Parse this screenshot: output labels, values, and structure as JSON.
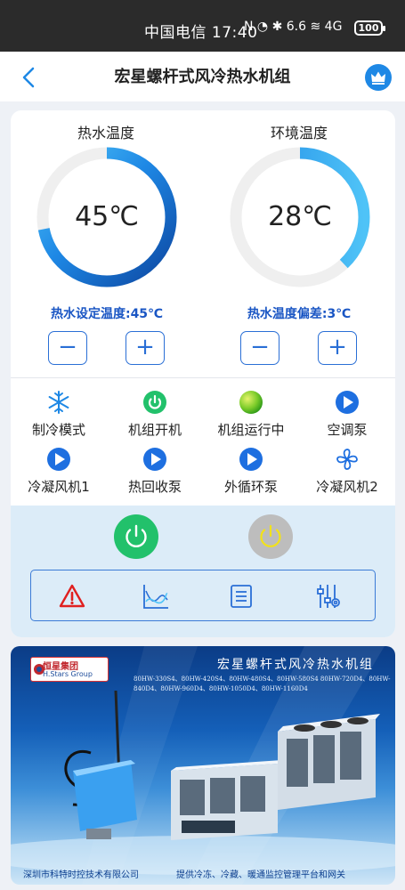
{
  "statusbar": {
    "carrier_time": "中国电信 17:40",
    "indicators": "N ◔ ✱ 6.6 ≋ 4G",
    "battery": "100"
  },
  "header": {
    "title": "宏星螺杆式风冷热水机组",
    "back_icon": "chevron-left-icon",
    "crown_icon": "crown-icon"
  },
  "gauges": {
    "hot_water": {
      "label": "热水温度",
      "value": "45℃",
      "fill": 0.72,
      "color_start": "#1565c0",
      "color_end": "#4fc3f7"
    },
    "ambient": {
      "label": "环境温度",
      "value": "28℃",
      "fill": 0.38,
      "color_start": "#1e88e5",
      "color_end": "#4fc3f7"
    }
  },
  "settings": {
    "setpoint": {
      "text": "热水设定温度:45℃",
      "minus": "−",
      "plus": "+"
    },
    "deviation": {
      "text": "热水温度偏差:3℃",
      "minus": "−",
      "plus": "+"
    }
  },
  "status_items": [
    {
      "label": "制冷模式",
      "icon": "snowflake-icon"
    },
    {
      "label": "机组开机",
      "icon": "power-green-icon"
    },
    {
      "label": "机组运行中",
      "icon": "running-light-icon"
    },
    {
      "label": "空调泵",
      "icon": "play-icon"
    },
    {
      "label": "冷凝风机1",
      "icon": "play-icon"
    },
    {
      "label": "热回收泵",
      "icon": "play-icon"
    },
    {
      "label": "外循环泵",
      "icon": "play-icon"
    },
    {
      "label": "冷凝风机2",
      "icon": "fan-icon"
    }
  ],
  "controls": {
    "power_on_icon": "power-on-icon",
    "power_off_icon": "power-off-icon",
    "tools": [
      "alarm-icon",
      "trend-chart-icon",
      "list-icon",
      "settings-sliders-icon"
    ]
  },
  "banner": {
    "logo_cn": "恒星集团",
    "logo_en": "H.Stars Group",
    "title": "宏星螺杆式风冷热水机组",
    "models": "80HW-330S4、80HW-420S4、80HW-480S4、80HW-580S4 80HW-720D4、80HW-840D4、80HW-960D4、80HW-1050D4、80HW-1160D4",
    "company": "深圳市科特时控技术有限公司",
    "slogan": "提供冷冻、冷藏、暖通监控管理平台和网关"
  },
  "colors": {
    "accent": "#1e88e5",
    "on": "#22c16b",
    "off": "#bdbdbd",
    "panel": "#dcecf8"
  }
}
